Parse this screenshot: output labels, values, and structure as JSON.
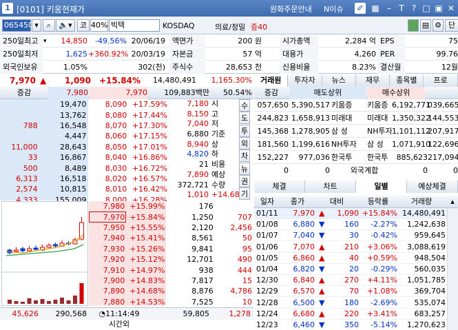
{
  "window": {
    "code_tag": "[0101]",
    "title": "키움현재가",
    "link_order": "원화주문안내",
    "link_issue": "N이슈",
    "btn_t": "T",
    "btn_q": "?"
  },
  "toolbar": {
    "code": "065450",
    "kosdaq_marker": "코",
    "margin_rate": "40%",
    "stock_name": "빅텍",
    "market": "KOSDAQ",
    "sector": "의료/정밀",
    "evidence": "증40",
    "right_btn": "단"
  },
  "info_rows": [
    {
      "l1": "250일최고",
      "v1": "14,850",
      "p1": "-49.56%",
      "d1": "20/06/19",
      "l2": "액면가",
      "v2": "200 원",
      "l3": "시가총액",
      "v3": "2,284 억",
      "l4": "EPS",
      "v4": "75"
    },
    {
      "l1": "250일최저",
      "v1": "1,625",
      "p1": "+360.92%",
      "d1": "20/03/19",
      "l2": "자본금",
      "v2": "57 억",
      "l3": "대용가",
      "v3": "4,260",
      "l4": "PER",
      "v4": "99.76"
    },
    {
      "l1": "외국인보유",
      "v1": "1.05%",
      "p1": "",
      "d1": "302(천)",
      "l2": "주식수",
      "v2": "28,653 천",
      "l3": "신용비율",
      "v3": "8.23%",
      "l4": "결산월",
      "v4": "12월"
    }
  ],
  "price": {
    "current": "7,970",
    "up_mark": "▲",
    "change": "1,090",
    "rate": "+15.84%",
    "volume": "14,480,491",
    "prev_volume": "1,165.30%"
  },
  "quote_header": {
    "label": "증감",
    "v1": "7,980",
    "v2": "7,970",
    "amount": "109,883백만",
    "ratio": "50.54%"
  },
  "ask_rows": [
    {
      "delta": "",
      "qty": "19,470",
      "price": "8,090",
      "rate": "+17.59%"
    },
    {
      "delta": "",
      "qty": "13,762",
      "price": "8,080",
      "rate": "+17.44%"
    },
    {
      "delta": "788",
      "qty": "16,548",
      "price": "8,070",
      "rate": "+17.30%"
    },
    {
      "delta": "",
      "qty": "4,447",
      "price": "8,060",
      "rate": "+17.15%"
    },
    {
      "delta": "11,000",
      "qty": "28,643",
      "price": "8,050",
      "rate": "+17.01%"
    },
    {
      "delta": "33",
      "qty": "16,867",
      "price": "8,040",
      "rate": "+16.86%"
    },
    {
      "delta": "500",
      "qty": "8,489",
      "price": "8,030",
      "rate": "+16.72%"
    },
    {
      "delta": "6,313",
      "qty": "16,518",
      "price": "8,020",
      "rate": "+16.57%"
    },
    {
      "delta": "2,574",
      "qty": "10,815",
      "price": "8,010",
      "rate": "+16.42%"
    },
    {
      "delta": "4,333",
      "qty": "155,009",
      "price": "8,000",
      "rate": "+16.28%"
    }
  ],
  "bid_rows": [
    {
      "price": "7,980",
      "rate": "+15.99%",
      "qty": "176",
      "delta": ""
    },
    {
      "price": "7,970",
      "rate": "+15.84%",
      "qty": "1,250",
      "delta": "707"
    },
    {
      "price": "7,950",
      "rate": "+15.55%",
      "qty": "2,120",
      "delta": "2,456"
    },
    {
      "price": "7,940",
      "rate": "+15.41%",
      "qty": "8,561",
      "delta": "50"
    },
    {
      "price": "7,930",
      "rate": "+15.26%",
      "qty": "9,841",
      "delta": "95"
    },
    {
      "price": "7,920",
      "rate": "+15.12%",
      "qty": "12,701",
      "delta": "490"
    },
    {
      "price": "7,910",
      "rate": "+14.97%",
      "qty": "938",
      "delta": "444"
    },
    {
      "price": "7,900",
      "rate": "+14.83%",
      "qty": "7,817",
      "delta": "15"
    },
    {
      "price": "7,890",
      "rate": "+14.68%",
      "qty": "8,876",
      "delta": "4,786"
    },
    {
      "price": "7,880",
      "rate": "+14.53%",
      "qty": "7,525",
      "delta": "10"
    }
  ],
  "quote_info": [
    {
      "v": "7,180",
      "k": "시"
    },
    {
      "v": "8,150",
      "k": "고"
    },
    {
      "v": "7,040",
      "k": "저"
    },
    {
      "v": "6,880",
      "k": "기준"
    },
    {
      "v": "8,940",
      "k": "상"
    },
    {
      "v": "4,820",
      "k": "하"
    },
    {
      "v": "21",
      "k": "비용"
    },
    {
      "v": "7,890",
      "k": "예상"
    },
    {
      "v": "372,721",
      "k": "수량"
    },
    {
      "v": "1,010",
      "k": "+14.68%"
    }
  ],
  "side_buttons": [
    "수",
    "도",
    "투",
    "외",
    "차",
    "뉴",
    "권",
    "기"
  ],
  "quote_footer": {
    "ask_total": "45,626",
    "ask_qty": "290,568",
    "time": "11:14:49",
    "time_label": "시간외",
    "bid_qty": "59,805",
    "bid_total": "1,278"
  },
  "broker_tabs": [
    "거래원",
    "투자자",
    "뉴스",
    "재무",
    "종목별",
    "프로"
  ],
  "broker_header": {
    "c0": "증감",
    "c1": "매도상위",
    "c2": "매수상위"
  },
  "broker_rows": [
    {
      "d": "057,650",
      "sq": "5,390,517",
      "sn": "키움증",
      "bn": "키움증",
      "bq": "6,192,771",
      "bd": "039,665"
    },
    {
      "d": "244,823",
      "sq": "1,658,913",
      "sn": "미래대",
      "bn": "미래대",
      "bq": "1,350,322",
      "bd": "144,553"
    },
    {
      "d": "145,368",
      "sq": "1,278,905",
      "sn": "삼 성",
      "bn": "NH투자",
      "bq": "1,101,112",
      "bd": "207,917"
    },
    {
      "d": "181,560",
      "sq": "1,199,616",
      "sn": "NH투자",
      "bn": "삼 성",
      "bq": "1,071,910",
      "bd": "122,696"
    },
    {
      "d": "152,227",
      "sq": "977,036",
      "sn": "한국투",
      "bn": "한국투",
      "bq": "885,623",
      "bd": "217,094"
    }
  ],
  "foreign_row": {
    "d": "0",
    "sq": "0",
    "label": "외국계합",
    "bq": "0",
    "bd": "0"
  },
  "daily_tabs": [
    "체결",
    "차트",
    "일별",
    "예상체결"
  ],
  "daily_header": [
    "일자",
    "종가",
    "대비",
    "등락률",
    "거래량"
  ],
  "daily_rows": [
    {
      "date": "01/11",
      "close": "7,970",
      "dir": "▲",
      "diff": "1,090",
      "rate": "+15.84%",
      "vol": "14,480,491",
      "up": true
    },
    {
      "date": "01/08",
      "close": "6,880",
      "dir": "▼",
      "diff": "160",
      "rate": "-2.27%",
      "vol": "1,242,638",
      "up": false
    },
    {
      "date": "01/07",
      "close": "7,040",
      "dir": "▼",
      "diff": "30",
      "rate": "-0.42%",
      "vol": "959,645",
      "up": false
    },
    {
      "date": "01/06",
      "close": "7,070",
      "dir": "▲",
      "diff": "210",
      "rate": "+3.06%",
      "vol": "3,088,619",
      "up": true
    },
    {
      "date": "01/05",
      "close": "6,860",
      "dir": "▲",
      "diff": "40",
      "rate": "+0.59%",
      "vol": "948,504",
      "up": true
    },
    {
      "date": "01/04",
      "close": "6,820",
      "dir": "▼",
      "diff": "20",
      "rate": "-0.29%",
      "vol": "560,035",
      "up": false
    },
    {
      "date": "12/30",
      "close": "6,840",
      "dir": "▲",
      "diff": "270",
      "rate": "+4.11%",
      "vol": "1,051,785",
      "up": true
    },
    {
      "date": "12/29",
      "close": "6,570",
      "dir": "▲",
      "diff": "70",
      "rate": "+1.08%",
      "vol": "369,704",
      "up": true
    },
    {
      "date": "12/28",
      "close": "6,500",
      "dir": "▼",
      "diff": "180",
      "rate": "-2.69%",
      "vol": "535,074",
      "up": false
    },
    {
      "date": "12/24",
      "close": "6,680",
      "dir": "▲",
      "diff": "220",
      "rate": "+3.41%",
      "vol": "683,257",
      "up": true
    },
    {
      "date": "12/23",
      "close": "6,460",
      "dir": "▼",
      "diff": "350",
      "rate": "-5.14%",
      "vol": "1,270,623",
      "up": false
    }
  ],
  "colors": {
    "up": "#d40000",
    "down": "#0033cc",
    "ask_bg": "#dbe8f7",
    "bid_bg": "#fbe3e3",
    "title_bg": "#4a78bc"
  }
}
